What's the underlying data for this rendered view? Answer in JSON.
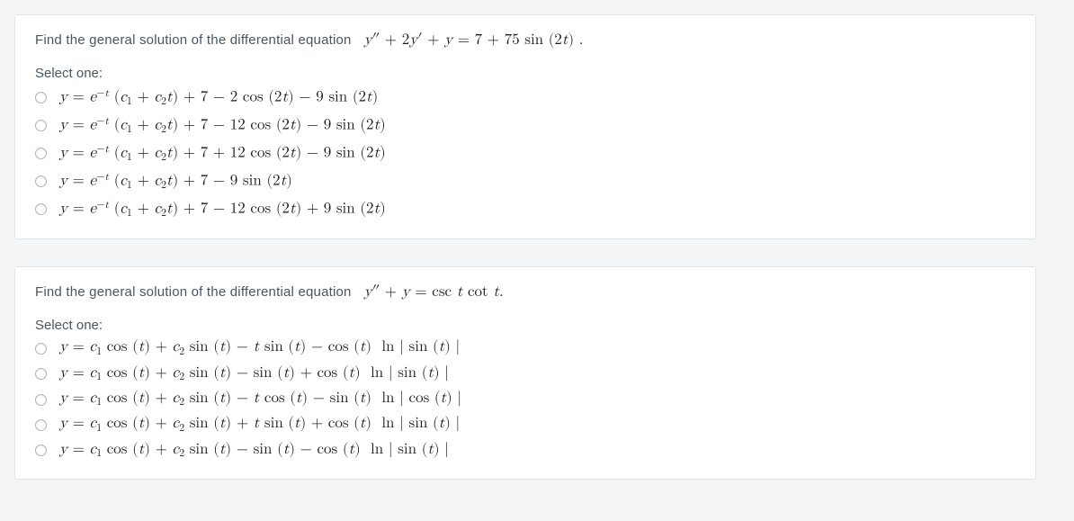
{
  "questions": [
    {
      "prompt_text": "Find the general solution of the differential equation",
      "equation_html": "<i>y</i>″ + 2<i>y</i>′ + <i>y</i> = 7 + 75 sin (2<i>t</i>) .",
      "select_one": "Select one:",
      "options": [
        "<i>y</i> = <i>e</i><span class=\"sup\">−<i>t</i></span> (<i>c</i><span class=\"sub\">1</span> + <i>c</i><span class=\"sub\">2</span><i>t</i>) + 7 − 2 cos (2<i>t</i>) − 9 sin (2<i>t</i>)",
        "<i>y</i> = <i>e</i><span class=\"sup\">−<i>t</i></span> (<i>c</i><span class=\"sub\">1</span> + <i>c</i><span class=\"sub\">2</span><i>t</i>) + 7 − 12 cos (2<i>t</i>) − 9 sin (2<i>t</i>)",
        "<i>y</i> = <i>e</i><span class=\"sup\">−<i>t</i></span> (<i>c</i><span class=\"sub\">1</span> + <i>c</i><span class=\"sub\">2</span><i>t</i>) + 7 + 12 cos (2<i>t</i>) − 9 sin (2<i>t</i>)",
        "<i>y</i> = <i>e</i><span class=\"sup\">−<i>t</i></span> (<i>c</i><span class=\"sub\">1</span> + <i>c</i><span class=\"sub\">2</span><i>t</i>) + 7 − 9 sin (2<i>t</i>)",
        "<i>y</i> = <i>e</i><span class=\"sup\">−<i>t</i></span> (<i>c</i><span class=\"sub\">1</span> + <i>c</i><span class=\"sub\">2</span><i>t</i>) + 7 − 12 cos (2<i>t</i>) + 9 sin (2<i>t</i>)"
      ]
    },
    {
      "prompt_text": "Find the general solution of the differential equation",
      "equation_html": "<i>y</i>″ + <i>y</i> = csc <i>t</i> cot <i>t</i>.",
      "select_one": "Select one:",
      "options": [
        "<i>y</i> = <i>c</i><span class=\"sub\">1</span> cos (<i>t</i>) + <i>c</i><span class=\"sub\">2</span> sin (<i>t</i>) − <i>t</i> sin (<i>t</i>) − cos (<i>t</i>) &nbsp;ln | sin (<i>t</i>) |",
        "<i>y</i> = <i>c</i><span class=\"sub\">1</span> cos (<i>t</i>) + <i>c</i><span class=\"sub\">2</span> sin (<i>t</i>) − sin (<i>t</i>) + cos (<i>t</i>) &nbsp;ln | sin (<i>t</i>) |",
        "<i>y</i> = <i>c</i><span class=\"sub\">1</span> cos (<i>t</i>) + <i>c</i><span class=\"sub\">2</span> sin (<i>t</i>) − <i>t</i> cos (<i>t</i>) − sin (<i>t</i>) &nbsp;ln | cos (<i>t</i>) |",
        "<i>y</i> = <i>c</i><span class=\"sub\">1</span> cos (<i>t</i>) + <i>c</i><span class=\"sub\">2</span> sin (<i>t</i>) + <i>t</i> sin (<i>t</i>) + cos (<i>t</i>) &nbsp;ln | sin (<i>t</i>) |",
        "<i>y</i> = <i>c</i><span class=\"sub\">1</span> cos (<i>t</i>) + <i>c</i><span class=\"sub\">2</span> sin (<i>t</i>) − sin (<i>t</i>) − cos (<i>t</i>) &nbsp;ln | sin (<i>t</i>) |"
      ]
    }
  ]
}
